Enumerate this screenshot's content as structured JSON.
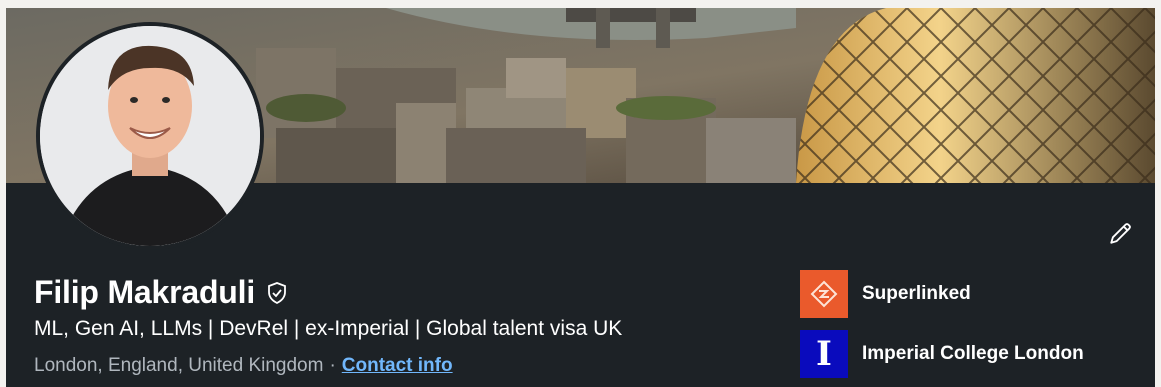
{
  "profile": {
    "name": "Filip Makraduli",
    "headline": "ML, Gen AI, LLMs | DevRel | ex-Imperial | Global talent visa UK",
    "location": "London, England, United Kingdom",
    "separator": "·",
    "contact_label": "Contact info"
  },
  "orgs": [
    {
      "name": "Superlinked",
      "logo_color": "#ea5a2c",
      "logo_glyph": "superlinked-logo"
    },
    {
      "name": "Imperial College London",
      "logo_color": "#0a0bbd",
      "logo_glyph": "I"
    }
  ],
  "icons": {
    "verified": "shield-check-icon",
    "edit": "pencil-icon"
  },
  "colors": {
    "card_bg": "#1d2226",
    "link": "#71b7fb",
    "muted": "#b0b7be"
  }
}
